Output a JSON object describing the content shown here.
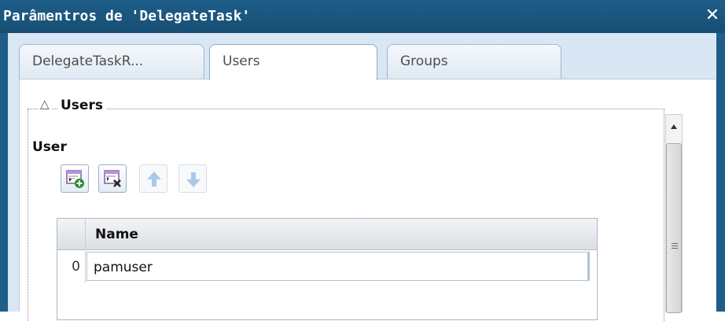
{
  "window": {
    "title": "Parâmentros de 'DelegateTask'",
    "close_label": "✕"
  },
  "tabs": [
    {
      "label": "DelegateTaskR...",
      "active": false
    },
    {
      "label": "Users",
      "active": true
    },
    {
      "label": "Groups",
      "active": false
    }
  ],
  "section": {
    "toggle_glyph": "△",
    "legend": "Users",
    "field_label": "User"
  },
  "toolbar": {
    "buttons": [
      {
        "icon": "add-row-icon",
        "enabled": true
      },
      {
        "icon": "delete-row-icon",
        "enabled": true
      },
      {
        "icon": "move-up-icon",
        "enabled": false
      },
      {
        "icon": "move-down-icon",
        "enabled": false
      }
    ]
  },
  "grid": {
    "columns": [
      "Name"
    ],
    "rows": [
      {
        "index": "0",
        "name": "pamuser"
      }
    ]
  },
  "colors": {
    "title_bar": "#1e5e89",
    "panel_background": "#d9e7f4",
    "icon_accent": "#2f8f2f",
    "arrow_disabled": "#a9c9ec"
  }
}
